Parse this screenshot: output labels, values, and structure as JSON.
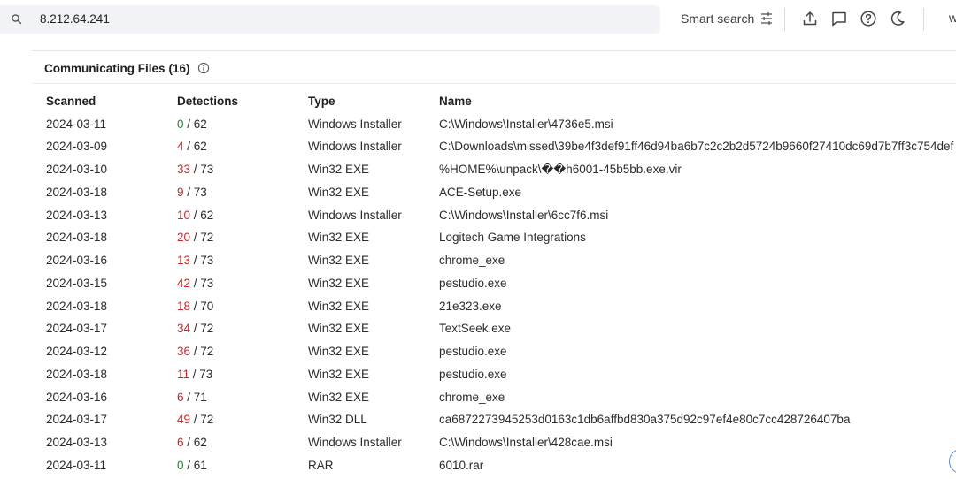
{
  "search": {
    "value": "8.212.64.241",
    "smart_search_label": "Smart search",
    "cutoff_text": "w"
  },
  "section": {
    "title": "Communicating Files",
    "count": "(16)"
  },
  "table": {
    "headers": {
      "scanned": "Scanned",
      "detections": "Detections",
      "type": "Type",
      "name": "Name"
    },
    "rows": [
      {
        "scanned": "2024-03-11",
        "det": "0",
        "total": "/ 62",
        "type": "Windows Installer",
        "name": "C:\\Windows\\Installer\\4736e5.msi"
      },
      {
        "scanned": "2024-03-09",
        "det": "4",
        "total": "/ 62",
        "type": "Windows Installer",
        "name": "C:\\Downloads\\missed\\39be4f3def91ff46d94ba6b7c2c2b2d5724b9660f27410dc69d7b7ff3c754def"
      },
      {
        "scanned": "2024-03-10",
        "det": "33",
        "total": "/ 73",
        "type": "Win32 EXE",
        "name": "%HOME%\\unpack\\��h6001-45b5bb.exe.vir"
      },
      {
        "scanned": "2024-03-18",
        "det": "9",
        "total": "/ 73",
        "type": "Win32 EXE",
        "name": "ACE-Setup.exe"
      },
      {
        "scanned": "2024-03-13",
        "det": "10",
        "total": "/ 62",
        "type": "Windows Installer",
        "name": "C:\\Windows\\Installer\\6cc7f6.msi"
      },
      {
        "scanned": "2024-03-18",
        "det": "20",
        "total": "/ 72",
        "type": "Win32 EXE",
        "name": "Logitech Game Integrations"
      },
      {
        "scanned": "2024-03-16",
        "det": "13",
        "total": "/ 73",
        "type": "Win32 EXE",
        "name": "chrome_exe"
      },
      {
        "scanned": "2024-03-15",
        "det": "42",
        "total": "/ 73",
        "type": "Win32 EXE",
        "name": "pestudio.exe"
      },
      {
        "scanned": "2024-03-18",
        "det": "18",
        "total": "/ 70",
        "type": "Win32 EXE",
        "name": "21e323.exe"
      },
      {
        "scanned": "2024-03-17",
        "det": "34",
        "total": "/ 72",
        "type": "Win32 EXE",
        "name": "TextSeek.exe"
      },
      {
        "scanned": "2024-03-12",
        "det": "36",
        "total": "/ 72",
        "type": "Win32 EXE",
        "name": "pestudio.exe"
      },
      {
        "scanned": "2024-03-18",
        "det": "11",
        "total": "/ 73",
        "type": "Win32 EXE",
        "name": "pestudio.exe"
      },
      {
        "scanned": "2024-03-16",
        "det": "6",
        "total": "/ 71",
        "type": "Win32 EXE",
        "name": "chrome_exe"
      },
      {
        "scanned": "2024-03-17",
        "det": "49",
        "total": "/ 72",
        "type": "Win32 DLL",
        "name": "ca6872273945253d0163c1db6affbd830a375d92c97ef4e80c7cc428726407ba"
      },
      {
        "scanned": "2024-03-13",
        "det": "6",
        "total": "/ 62",
        "type": "Windows Installer",
        "name": "C:\\Windows\\Installer\\428cae.msi"
      },
      {
        "scanned": "2024-03-11",
        "det": "0",
        "total": "/ 61",
        "type": "RAR",
        "name": "6010.rar"
      }
    ]
  },
  "colors": {
    "detection_positive": "#c62828",
    "detection_zero": "#2e7d32"
  },
  "icons": [
    "search-icon",
    "smart-search-filter-icon",
    "upload-icon",
    "comment-icon",
    "help-icon",
    "dark-mode-moon-icon",
    "info-icon"
  ]
}
